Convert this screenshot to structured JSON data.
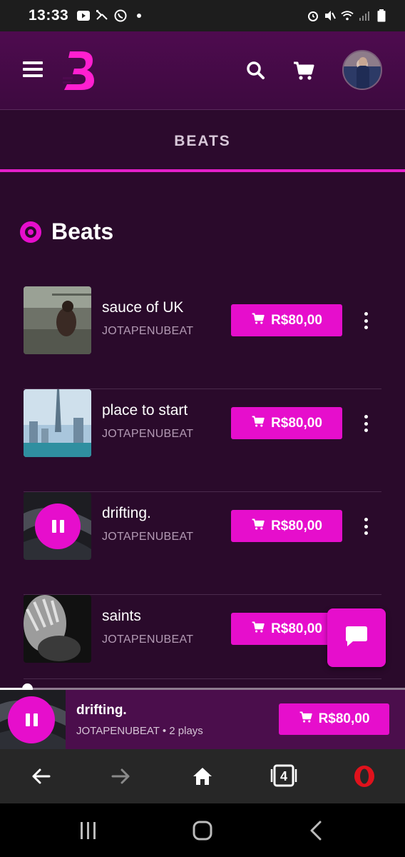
{
  "status_bar": {
    "time": "13:33",
    "left_icons": [
      "youtube-icon",
      "missed-call-icon",
      "whatsapp-icon",
      "dot-icon"
    ],
    "right_icons": [
      "alarm-icon",
      "mute-icon",
      "wifi-icon",
      "signal-icon",
      "battery-icon"
    ]
  },
  "header": {
    "logo_letter": "B",
    "icons": [
      "menu-icon",
      "search-icon",
      "cart-icon",
      "avatar"
    ]
  },
  "tabs": [
    {
      "label": "BEATS",
      "active": true
    }
  ],
  "section": {
    "title": "Beats",
    "icon": "disc-icon"
  },
  "beats": [
    {
      "title": "sauce of UK",
      "artist": "JOTAPENUBEAT",
      "price": "R$80,00",
      "thumb": "photo-person-sitting",
      "playing": false
    },
    {
      "title": "place to start",
      "artist": "JOTAPENUBEAT",
      "price": "R$80,00",
      "thumb": "photo-city-skyline",
      "playing": false
    },
    {
      "title": "drifting.",
      "artist": "JOTAPENUBEAT",
      "price": "R$80,00",
      "thumb": "photo-dark-abstract",
      "playing": true
    },
    {
      "title": "saints",
      "artist": "JOTAPENUBEAT",
      "price": "R$80,00",
      "thumb": "photo-bw-portrait",
      "playing": false
    }
  ],
  "player": {
    "title": "drifting.",
    "meta": "JOTAPENUBEAT • 2 plays",
    "price": "R$80,00",
    "progress": 0.067
  },
  "browser_nav": {
    "tabs_count": "4",
    "icons": [
      "back-arrow-icon",
      "forward-arrow-icon",
      "home-icon",
      "tabs-icon",
      "opera-icon"
    ]
  },
  "android_nav": {
    "icons": [
      "recents-icon",
      "home-icon",
      "back-icon"
    ]
  },
  "colors": {
    "accent": "#e60ecc",
    "background": "#2a0a2b",
    "header": "#4e0b4f",
    "muted_text": "#b39ab4"
  }
}
